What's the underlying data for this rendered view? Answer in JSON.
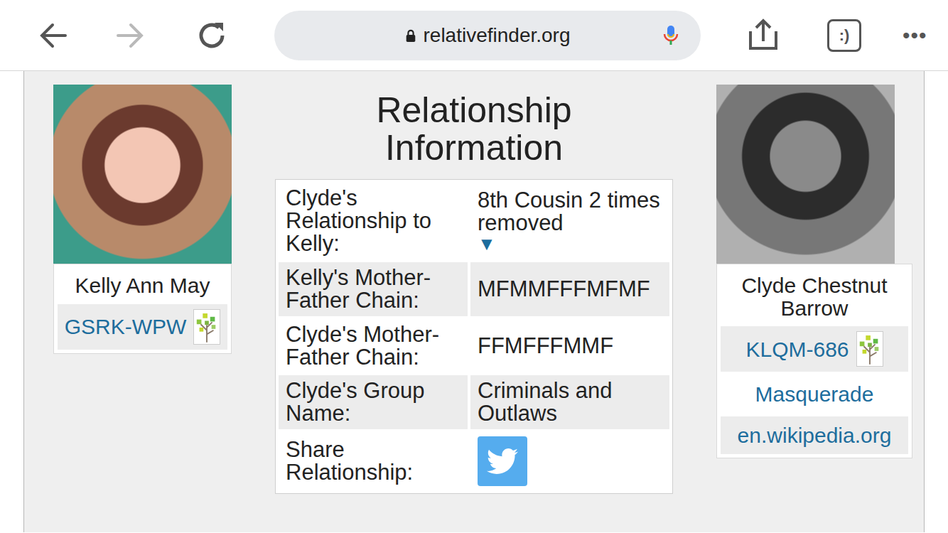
{
  "browser": {
    "url": "relativefinder.org",
    "tab_button": ":)",
    "menu": "•••",
    "forward_disabled": true
  },
  "person": {
    "name": "Kelly Ann May",
    "id": "GSRK-WPW"
  },
  "relative": {
    "name": "Clyde Chestnut Barrow",
    "id": "KLQM-686",
    "links": [
      "Masquerade",
      "en.wikipedia.org"
    ]
  },
  "title": "Relationship Information",
  "table": {
    "rows": [
      {
        "label": "Clyde's Relationship to Kelly:",
        "value": "8th Cousin 2 times removed",
        "toggle": "▼",
        "kind": "dropdown"
      },
      {
        "label": "Kelly's Mother-Father Chain:",
        "value": "MFMMFFFMFMF",
        "kind": "text"
      },
      {
        "label": "Clyde's Mother-Father Chain:",
        "value": "FFMFFFMMF",
        "kind": "text"
      },
      {
        "label": "Clyde's Group Name:",
        "value": "Criminals and Outlaws",
        "kind": "text"
      },
      {
        "label": "Share Relationship:",
        "value": "",
        "kind": "share"
      }
    ]
  }
}
